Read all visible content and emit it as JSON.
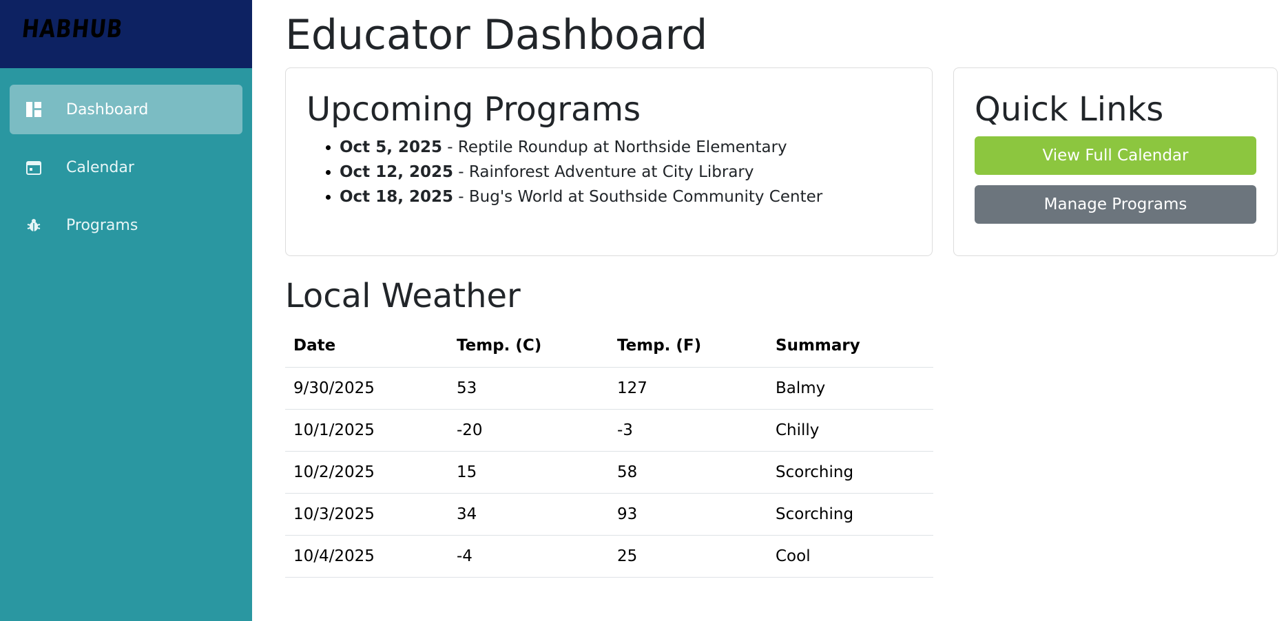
{
  "brand": {
    "logo_text": "HABHUB"
  },
  "sidebar": {
    "items": [
      {
        "label": "Dashboard",
        "icon": "dashboard-icon",
        "active": true
      },
      {
        "label": "Calendar",
        "icon": "calendar-icon",
        "active": false
      },
      {
        "label": "Programs",
        "icon": "bug-icon",
        "active": false
      }
    ]
  },
  "page": {
    "title": "Educator Dashboard"
  },
  "programs": {
    "title": "Upcoming Programs",
    "items": [
      {
        "date": "Oct 5, 2025",
        "text": " - Reptile Roundup at Northside Elementary"
      },
      {
        "date": "Oct 12, 2025",
        "text": " - Rainforest Adventure at City Library"
      },
      {
        "date": "Oct 18, 2025",
        "text": " - Bug's World at Southside Community Center"
      }
    ]
  },
  "quick_links": {
    "title": "Quick Links",
    "buttons": [
      {
        "label": "View Full Calendar",
        "color": "#8cc63f"
      },
      {
        "label": "Manage Programs",
        "color": "#6c757d"
      }
    ]
  },
  "weather": {
    "title": "Local Weather",
    "columns": [
      "Date",
      "Temp. (C)",
      "Temp. (F)",
      "Summary"
    ],
    "rows": [
      [
        "9/30/2025",
        "53",
        "127",
        "Balmy"
      ],
      [
        "10/1/2025",
        "-20",
        "-3",
        "Chilly"
      ],
      [
        "10/2/2025",
        "15",
        "58",
        "Scorching"
      ],
      [
        "10/3/2025",
        "34",
        "93",
        "Scorching"
      ],
      [
        "10/4/2025",
        "-4",
        "25",
        "Cool"
      ]
    ]
  },
  "colors": {
    "sidebar_bg": "#2a97a1",
    "brand_bg": "#0d2262",
    "active_item_bg": "#7bbcc3"
  }
}
